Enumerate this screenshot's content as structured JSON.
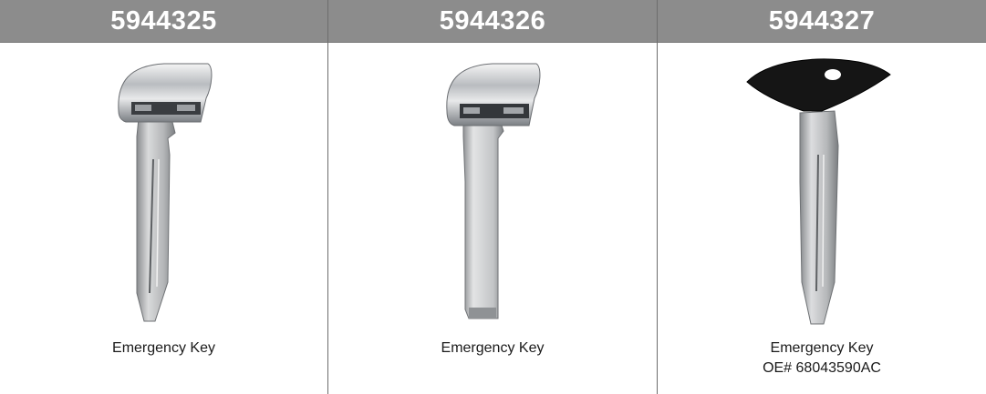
{
  "products": [
    {
      "part_number": "5944325",
      "caption": "Emergency Key",
      "oe_number": "",
      "head_style": "chrome"
    },
    {
      "part_number": "5944326",
      "caption": "Emergency Key",
      "oe_number": "",
      "head_style": "chrome"
    },
    {
      "part_number": "5944327",
      "caption": "Emergency Key",
      "oe_number": "OE# 68043590AC",
      "head_style": "black"
    }
  ],
  "colors": {
    "header_bg": "#8c8c8c",
    "header_text": "#ffffff",
    "divider": "#6d6d6d"
  }
}
